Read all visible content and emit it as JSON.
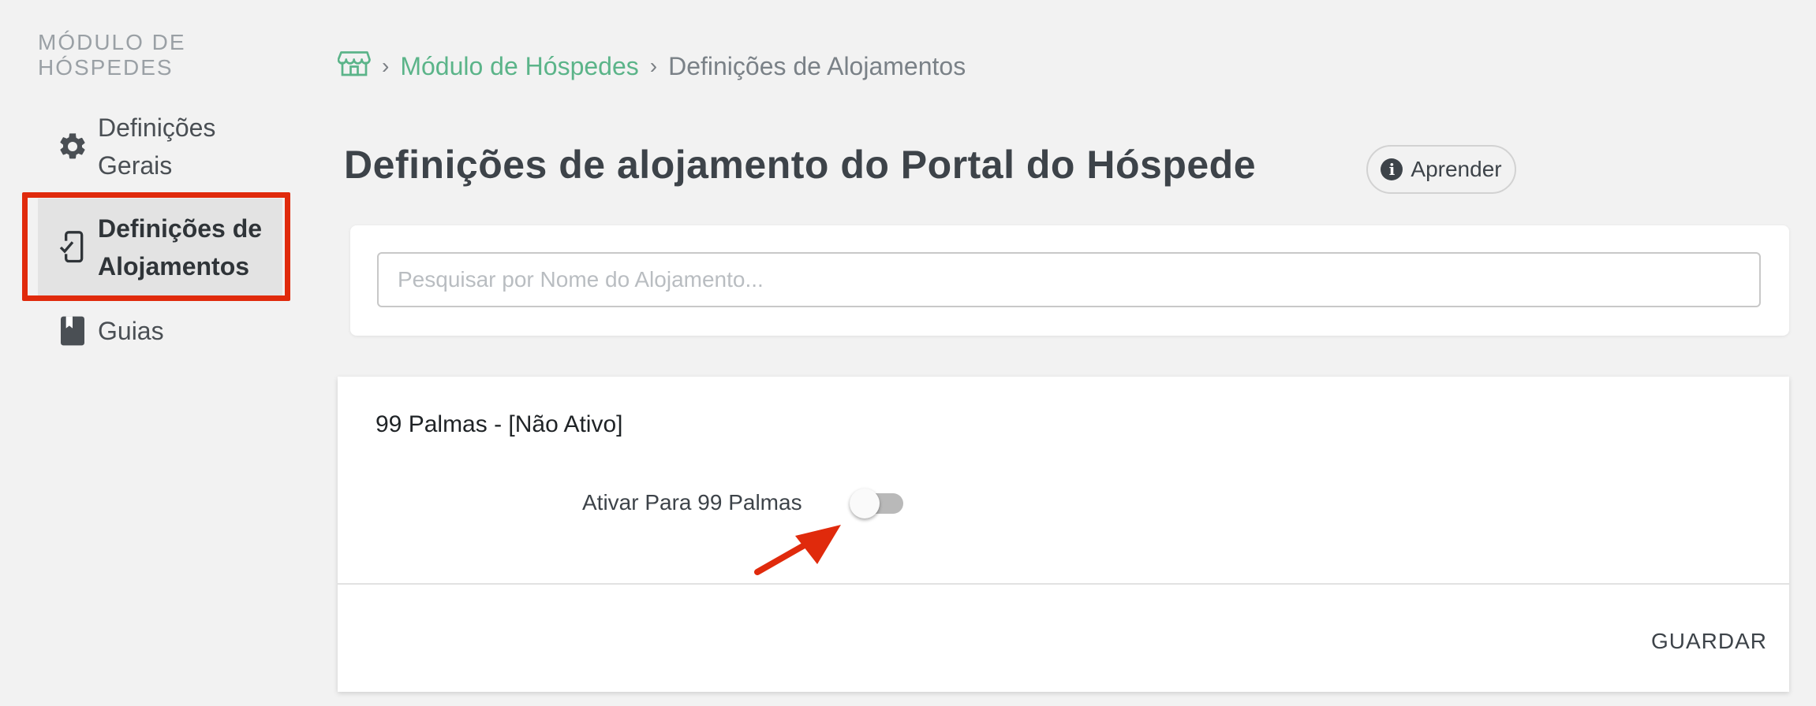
{
  "sidebar": {
    "heading": "MÓDULO DE HÓSPEDES",
    "items": [
      {
        "label": "Definições Gerais",
        "icon": "gear-icon",
        "active": false
      },
      {
        "label": "Definições de Alojamentos",
        "icon": "mobile-check-icon",
        "active": true
      },
      {
        "label": "Guias",
        "icon": "book-icon",
        "active": false
      }
    ]
  },
  "breadcrumb": {
    "home_icon": "storefront-icon",
    "items": [
      "Módulo de Hóspedes",
      "Definições de Alojamentos"
    ]
  },
  "header": {
    "title": "Definições de alojamento do Portal do Hóspede",
    "learn_label": "Aprender"
  },
  "search": {
    "placeholder": "Pesquisar por Nome do Alojamento...",
    "value": ""
  },
  "lodging": {
    "name": "99 Palmas - [Não Ativo]",
    "toggle_label": "Ativar Para 99 Palmas",
    "enabled": false,
    "save_label": "GUARDAR"
  },
  "colors": {
    "accent_green": "#5bb489",
    "annotation_red": "#e02a0c",
    "toggle_off": "#b9b9b9"
  }
}
